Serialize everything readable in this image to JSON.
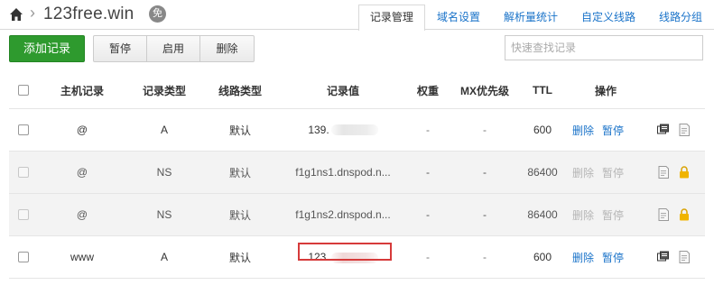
{
  "header": {
    "domain": "123free.win",
    "badge": "免"
  },
  "tabs": [
    {
      "label": "记录管理",
      "active": true
    },
    {
      "label": "域名设置",
      "active": false
    },
    {
      "label": "解析量统计",
      "active": false
    },
    {
      "label": "自定义线路",
      "active": false
    },
    {
      "label": "线路分组",
      "active": false
    }
  ],
  "toolbar": {
    "add_label": "添加记录",
    "pause_label": "暂停",
    "enable_label": "启用",
    "delete_label": "删除",
    "search_placeholder": "快速查找记录"
  },
  "table": {
    "headers": {
      "host": "主机记录",
      "type": "记录类型",
      "line": "线路类型",
      "value": "记录值",
      "weight": "权重",
      "mx": "MX优先级",
      "ttl": "TTL",
      "ops": "操作"
    },
    "rows": [
      {
        "host": "@",
        "type": "A",
        "line": "默认",
        "value": "139.",
        "weight": "-",
        "mx": "-",
        "ttl": "600",
        "delete": "删除",
        "pause": "暂停"
      },
      {
        "host": "@",
        "type": "NS",
        "line": "默认",
        "value": "f1g1ns1.dnspod.n...",
        "weight": "-",
        "mx": "-",
        "ttl": "86400",
        "delete": "删除",
        "pause": "暂停"
      },
      {
        "host": "@",
        "type": "NS",
        "line": "默认",
        "value": "f1g1ns2.dnspod.n...",
        "weight": "-",
        "mx": "-",
        "ttl": "86400",
        "delete": "删除",
        "pause": "暂停"
      },
      {
        "host": "www",
        "type": "A",
        "line": "默认",
        "value": "123.",
        "weight": "-",
        "mx": "-",
        "ttl": "600",
        "delete": "删除",
        "pause": "暂停"
      }
    ]
  },
  "colors": {
    "accent_green": "#2e9a2e",
    "link_blue": "#1a73c9",
    "highlight_red": "#d63a3a",
    "lock_yellow": "#f0b400"
  }
}
